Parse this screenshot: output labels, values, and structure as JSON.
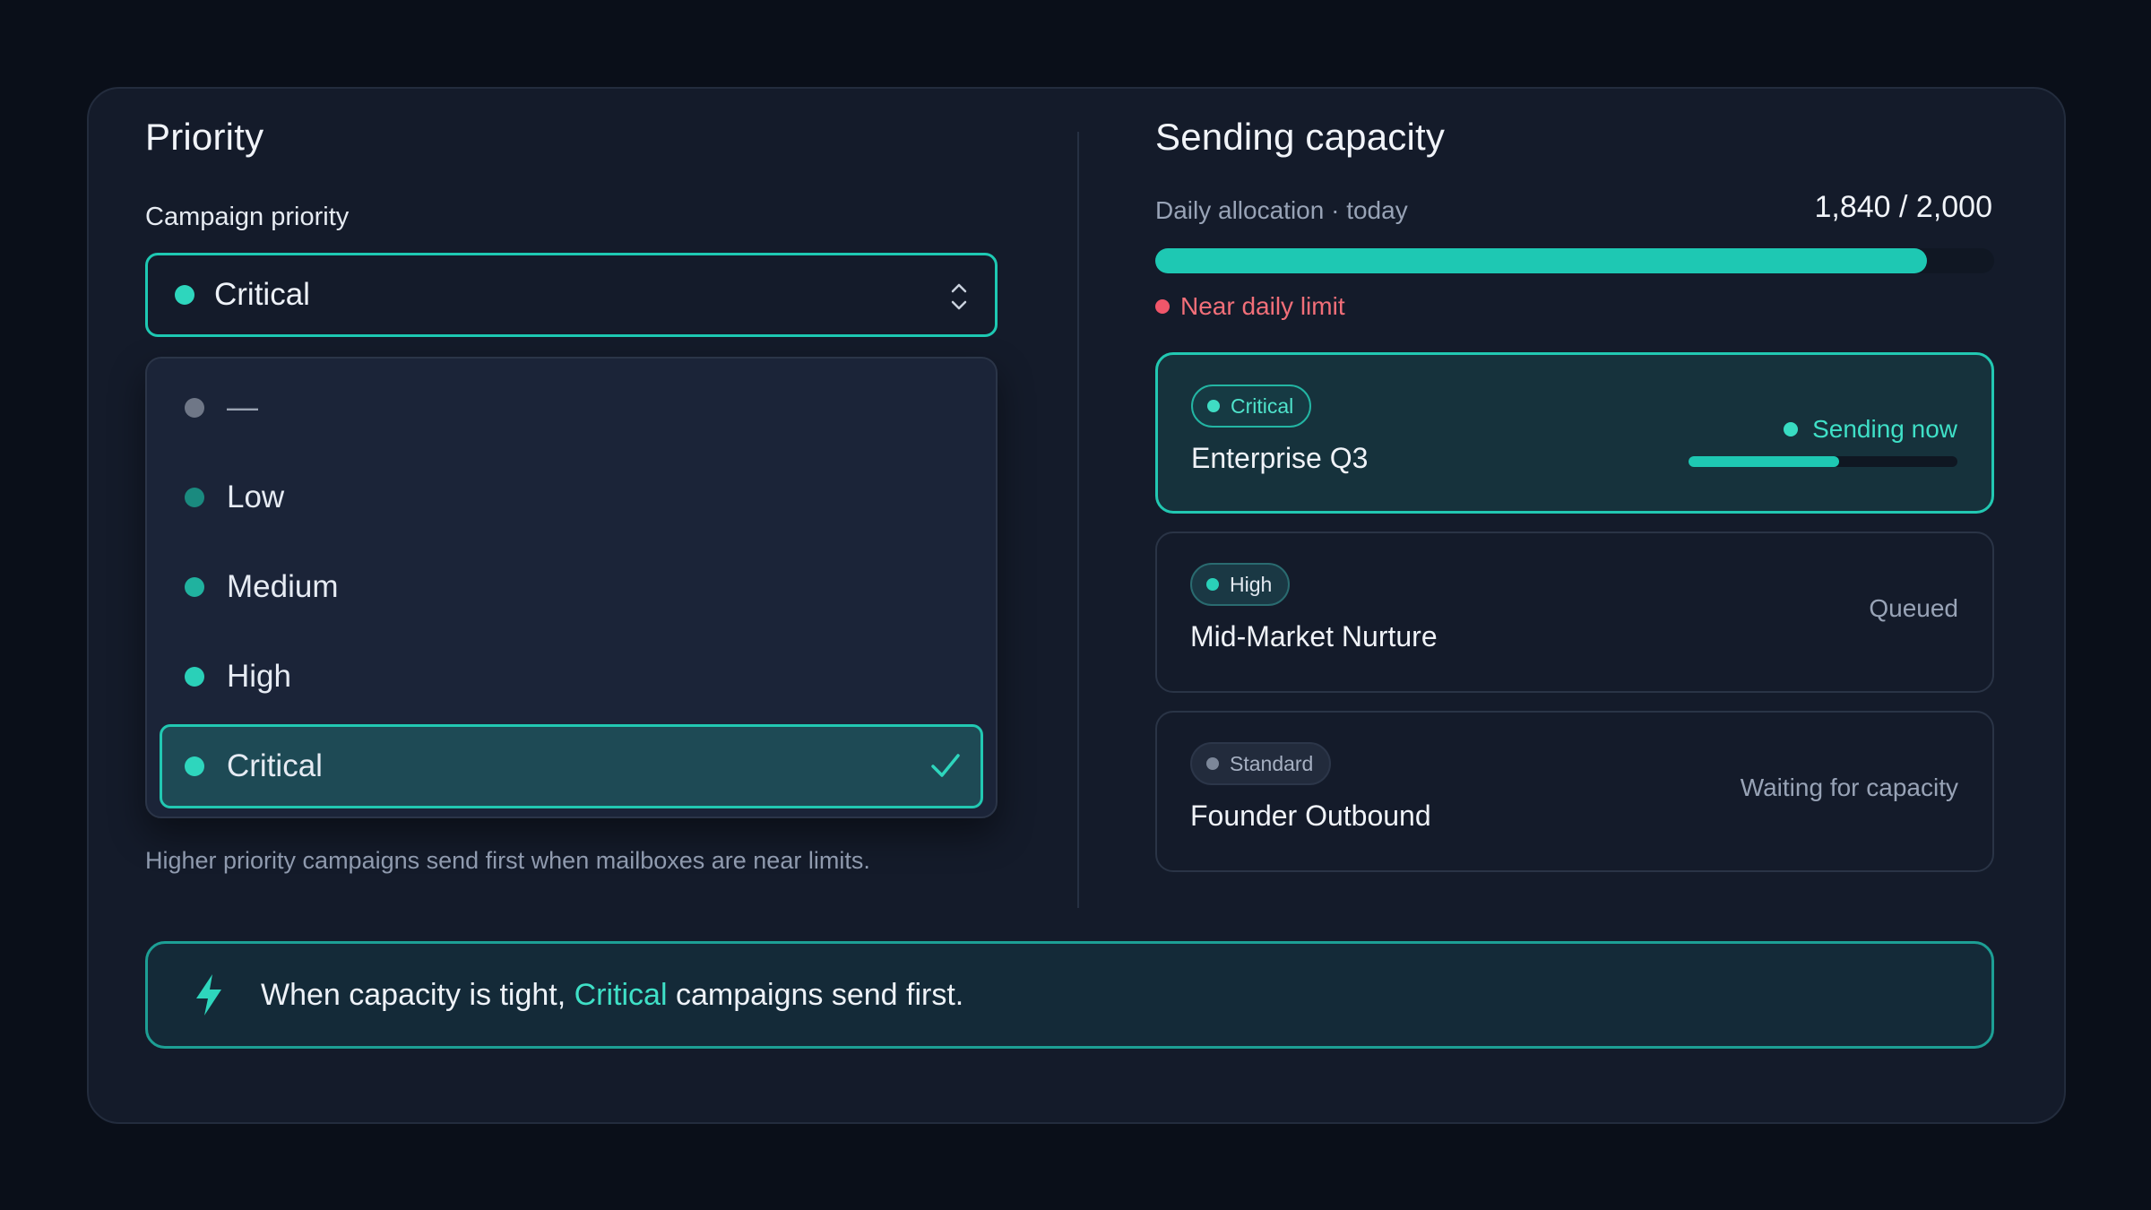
{
  "priority": {
    "title": "Priority",
    "field_label": "Campaign priority",
    "selected": "Critical",
    "options": [
      {
        "label": "—",
        "color": "#6f7787"
      },
      {
        "label": "Low",
        "color": "#1a8a7f"
      },
      {
        "label": "Medium",
        "color": "#20b29f"
      },
      {
        "label": "High",
        "color": "#2ad0b8"
      },
      {
        "label": "Critical",
        "color": "#2ed6bd"
      }
    ],
    "helper": "Higher priority campaigns send first when mailboxes are near limits."
  },
  "capacity": {
    "title": "Sending capacity",
    "alloc_label": "Daily allocation · today",
    "alloc_count": "1,840 / 2,000",
    "fill_fraction": 0.92,
    "limit_warning": "Near daily limit",
    "campaigns": [
      {
        "badge": "Critical",
        "name": "Enterprise Q3",
        "status": "Sending now",
        "progress": 0.56
      },
      {
        "badge": "High",
        "name": "Mid-Market Nurture",
        "status": "Queued"
      },
      {
        "badge": "Standard",
        "name": "Founder Outbound",
        "status": "Waiting for capacity"
      }
    ]
  },
  "banner": {
    "prefix": "When capacity is tight, ",
    "highlight": "Critical",
    "suffix": " campaigns send first."
  },
  "colors": {
    "accent": "#1ec8b3",
    "warning": "#f0566a"
  }
}
